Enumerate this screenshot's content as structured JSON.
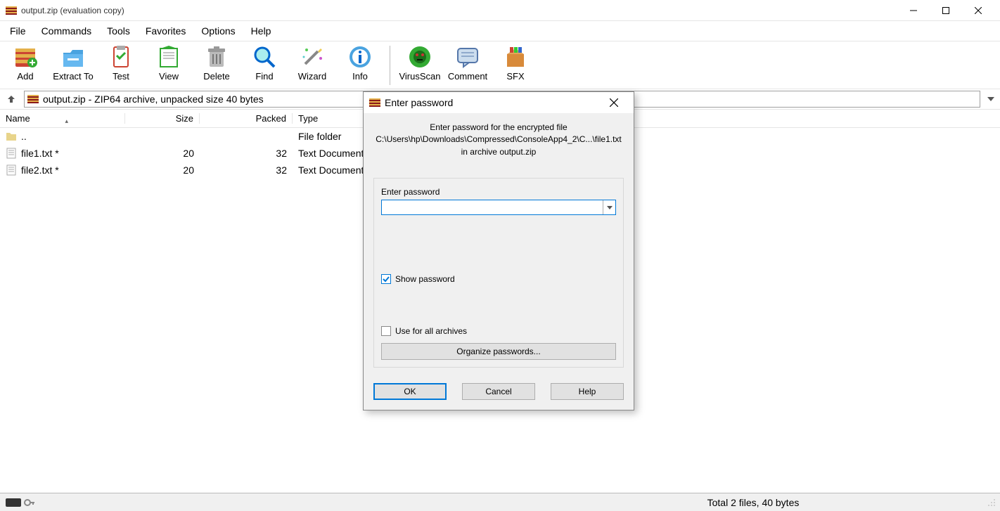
{
  "window": {
    "title": "output.zip (evaluation copy)"
  },
  "menus": [
    "File",
    "Commands",
    "Tools",
    "Favorites",
    "Options",
    "Help"
  ],
  "toolbar": [
    {
      "key": "add",
      "label": "Add"
    },
    {
      "key": "extract-to",
      "label": "Extract To"
    },
    {
      "key": "test",
      "label": "Test"
    },
    {
      "key": "view",
      "label": "View"
    },
    {
      "key": "delete",
      "label": "Delete"
    },
    {
      "key": "find",
      "label": "Find"
    },
    {
      "key": "wizard",
      "label": "Wizard"
    },
    {
      "key": "info",
      "label": "Info"
    },
    {
      "key": "virusscan",
      "label": "VirusScan"
    },
    {
      "key": "comment",
      "label": "Comment"
    },
    {
      "key": "sfx",
      "label": "SFX"
    }
  ],
  "address": "output.zip - ZIP64 archive, unpacked size 40 bytes",
  "columns": {
    "name": "Name",
    "size": "Size",
    "packed": "Packed",
    "type": "Type"
  },
  "rows": [
    {
      "name": "..",
      "size": "",
      "packed": "",
      "type": "File folder",
      "icon": "folder"
    },
    {
      "name": "file1.txt *",
      "size": "20",
      "packed": "32",
      "type": "Text Document",
      "icon": "text"
    },
    {
      "name": "file2.txt *",
      "size": "20",
      "packed": "32",
      "type": "Text Document",
      "icon": "text"
    }
  ],
  "status": {
    "summary": "Total 2 files, 40 bytes"
  },
  "dialog": {
    "title": "Enter password",
    "line1": "Enter password for the encrypted file",
    "line2": "C:\\Users\\hp\\Downloads\\Compressed\\ConsoleApp4_2\\C...\\file1.txt",
    "line3": "in archive output.zip",
    "field_label": "Enter password",
    "show_pw": "Show password",
    "use_all": "Use for all archives",
    "organize": "Organize passwords...",
    "ok": "OK",
    "cancel": "Cancel",
    "help": "Help"
  }
}
